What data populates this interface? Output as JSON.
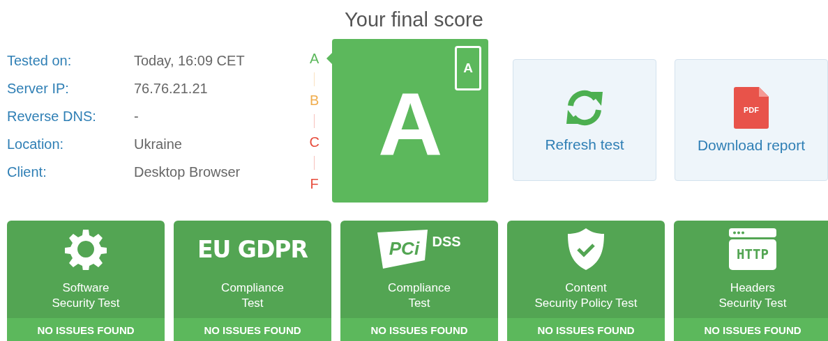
{
  "title": "Your final score",
  "info": [
    {
      "label": "Tested on:",
      "value": "Today, 16:09 CET"
    },
    {
      "label": "Server IP:",
      "value": "76.76.21.21"
    },
    {
      "label": "Reverse DNS:",
      "value": "-"
    },
    {
      "label": "Location:",
      "value": "Ukraine"
    },
    {
      "label": "Client:",
      "value": "Desktop Browser"
    }
  ],
  "grade_scale": [
    {
      "grade": "A",
      "color": "#5cb85c",
      "selected": true
    },
    {
      "grade": "B",
      "color": "#f0ad4e",
      "selected": false
    },
    {
      "grade": "C",
      "color": "#e74c3c",
      "selected": false
    },
    {
      "grade": "F",
      "color": "#e74c3c",
      "selected": false
    }
  ],
  "score": {
    "grade": "A",
    "mobile_grade": "A"
  },
  "actions": [
    {
      "kind": "refresh",
      "label": "Refresh test"
    },
    {
      "kind": "pdf",
      "label": "Download report",
      "icon_text": "PDF"
    }
  ],
  "cards": [
    {
      "kind": "gear",
      "title": "Software\nSecurity Test",
      "status": "NO ISSUES FOUND"
    },
    {
      "kind": "text_logo",
      "logo_text": "EU GDPR",
      "title": "Compliance\nTest",
      "status": "NO ISSUES FOUND"
    },
    {
      "kind": "pci",
      "logo_text": "PCi",
      "logo_suffix": "DSS",
      "title": "Compliance\nTest",
      "status": "NO ISSUES FOUND"
    },
    {
      "kind": "shield",
      "title": "Content\nSecurity Policy Test",
      "status": "NO ISSUES FOUND"
    },
    {
      "kind": "http",
      "logo_text": "HTTP",
      "title": "Headers\nSecurity Test",
      "status": "NO ISSUES FOUND"
    }
  ]
}
